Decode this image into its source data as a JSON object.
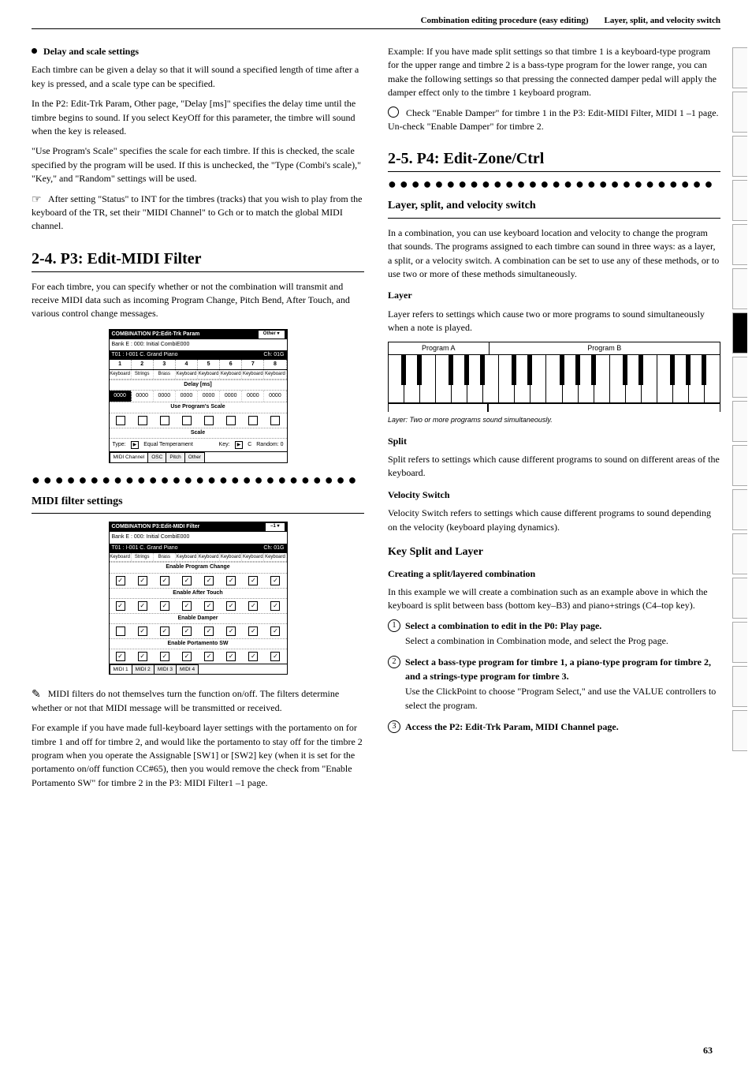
{
  "header": {
    "left": "Combination editing procedure (easy editing)",
    "right": "Layer, split, and velocity switch"
  },
  "left_col": {
    "bullet_label": "Delay and scale settings",
    "p1": "Each timbre can be given a delay so that it will sound a specified length of time after a key is pressed, and a scale type can be specified.",
    "p2": "In the P2: Edit-Trk Param, Other page, \"Delay [ms]\" specifies the delay time until the timbre begins to sound. If you select KeyOff for this parameter, the timbre will sound when the key is released.",
    "p3": "\"Use Program's Scale\" specifies the scale for each timbre. If this is checked, the scale specified by the program will be used. If this is unchecked, the \"Type (Combi's scale),\" \"Key,\" and \"Random\" settings will be used.",
    "hand_note": "After setting \"Status\" to INT for the timbres (tracks) that you wish to play from the keyboard of the TR, set their \"MIDI Channel\" to Gch or to match the global MIDI channel.",
    "h2_num": "2-4",
    "h2_title": "P3: Edit-MIDI Filter",
    "after_h2": "For each timbre, you can specify whether or not the combination will transmit and receive MIDI data such as incoming Program Change, Pitch Bend, After Touch, and various control change messages.",
    "dot_title": "MIDI filter settings",
    "pencil_note": "MIDI filters do not themselves turn the function on/off. The filters determine whether or not that MIDI message will be transmitted or received.",
    "last_p": "For example if you have made full-keyboard layer settings with the portamento on for timbre 1 and off for timbre 2, and would like the portamento to stay off for the timbre 2 program when you operate the Assignable [SW1] or [SW2] key (when it is set for the portamento on/off function CC#65), then you would remove the check from \"Enable Portamento SW\" for timbre 2 in the P3: MIDI Filter1 –1 page."
  },
  "right_col": {
    "p1": "Example: If you have made split settings so that timbre 1 is a keyboard-type program for the upper range and timbre 2 is a bass-type program for the lower range, you can make the following settings so that pressing the connected damper pedal will apply the damper effect only to the timbre 1 keyboard program.",
    "circle_step": "Check \"Enable Damper\" for timbre 1 in the P3: Edit-MIDI Filter, MIDI 1 –1 page. Un-check \"Enable Damper\" for timbre 2.",
    "h2_num": "2-5",
    "h2_title": "P4: Edit-Zone/Ctrl",
    "dot_title": "Layer, split, and velocity switch",
    "intro_p": "In a combination, you can use keyboard location and velocity to change the program that sounds. The programs assigned to each timbre can sound in three ways: as a layer, a split, or a velocity switch. A combination can be set to use any of these methods, or to use two or more of these methods simultaneously.",
    "h4_layer": "Layer",
    "layer_p": "Layer refers to settings which cause two or more programs to sound simultaneously when a note is played.",
    "kb": {
      "label1": "Program A",
      "label2": "Program B",
      "caption": "Layer: Two or more programs sound simultaneously."
    },
    "h4_split": "Split",
    "split_p": "Split refers to settings which cause different programs to sound on different areas of the keyboard.",
    "h4_velsw": "Velocity Switch",
    "velsw_p": "Velocity Switch refers to settings which cause different programs to sound depending on the velocity (keyboard playing dynamics).",
    "h3": "Key Split and Layer",
    "example_title": "Creating a split/layered combination",
    "example_p": "In this example we will create a combination such as an example above in which the keyboard is split between bass (bottom key–B3) and piano+strings (C4–top key).",
    "step1": "Select a combination to edit in the P0: Play page.",
    "step1_sub": "Select a combination in Combination mode, and select the Prog page.",
    "step2": "Select a bass-type program for timbre 1, a piano-type program for timbre 2, and a strings-type program for timbre 3.",
    "step2_sub": "Use the ClickPoint to choose \"Program Select,\" and use the VALUE controllers to select the program.",
    "step3": "Access the P2: Edit-Trk Param, MIDI Channel page."
  },
  "screenshots": {
    "trk": {
      "title": "COMBINATION P2:Edit-Trk Param",
      "menu": "Other",
      "bank": "Bank E : 000: Initial CombiE000",
      "hdr_t": "T01 : I-001 C. Grand Piano",
      "hdr_ch": "Ch: 01G",
      "progs": [
        "Keyboard",
        "Strings",
        "Brass",
        "Keyboard",
        "Keyboard",
        "Keyboard",
        "Keyboard",
        "Keyboard"
      ],
      "delay_label": "Delay [ms]",
      "delay_vals": [
        "0000",
        "0000",
        "0000",
        "0000",
        "0000",
        "0000",
        "0000",
        "0000"
      ],
      "ups_label": "Use Program's Scale",
      "scale_label": "Scale",
      "type_label": "Type:",
      "type_val": "Equal Temperament",
      "key_label": "Key:",
      "key_val": "C",
      "rand_label": "Random: 0",
      "tabs": [
        "MIDI Channel",
        "OSC",
        "Pitch",
        "Other"
      ]
    },
    "filter": {
      "title": "COMBINATION P3:Edit-MIDI Filter",
      "menu": "–1",
      "bank": "Bank E : 000: Initial CombiE000",
      "hdr_t": "T01 : I-001 C. Grand Piano",
      "hdr_ch": "Ch: 01G",
      "progs": [
        "Keyboard",
        "Strings",
        "Brass",
        "Keyboard",
        "Keyboard",
        "Keyboard",
        "Keyboard",
        "Keyboard"
      ],
      "row1": "Enable Program Change",
      "row2": "Enable After Touch",
      "row3": "Enable Damper",
      "row4": "Enable Portamento SW",
      "tabs": [
        "MIDI 1",
        "MIDI 2",
        "MIDI 3",
        "MIDI 4"
      ]
    }
  },
  "page_number": "63"
}
